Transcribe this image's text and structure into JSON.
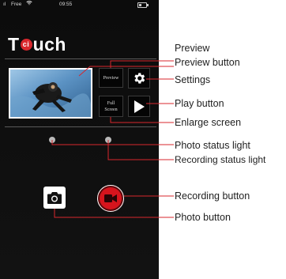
{
  "status_bar": {
    "signal": "ıl",
    "carrier": "Free",
    "wifi_icon": "wifi-icon",
    "time": "09:55",
    "battery_icon": "battery-icon"
  },
  "app": {
    "logo_prefix": "T",
    "logo_badge": "ci",
    "logo_suffix": "uch"
  },
  "buttons": {
    "preview_label": "Preview",
    "fullscreen_label": "Full\nScreen",
    "settings_icon": "gear-icon",
    "play_icon": "play-icon",
    "photo_icon": "camera-icon",
    "record_icon": "video-camera-icon"
  },
  "annotations": {
    "preview": "Preview",
    "preview_button": "Preview button",
    "settings": "Settings",
    "play_button": "Play button",
    "enlarge_screen": "Enlarge screen",
    "photo_status_light": "Photo status light",
    "recording_status_light": "Recording status light",
    "recording_button": "Recording button",
    "photo_button": "Photo button"
  },
  "colors": {
    "callout_line": "#d8272d",
    "record_button": "#d6141d",
    "status_light": "#b9b9b9",
    "phone_background": "#0c0c0c"
  }
}
